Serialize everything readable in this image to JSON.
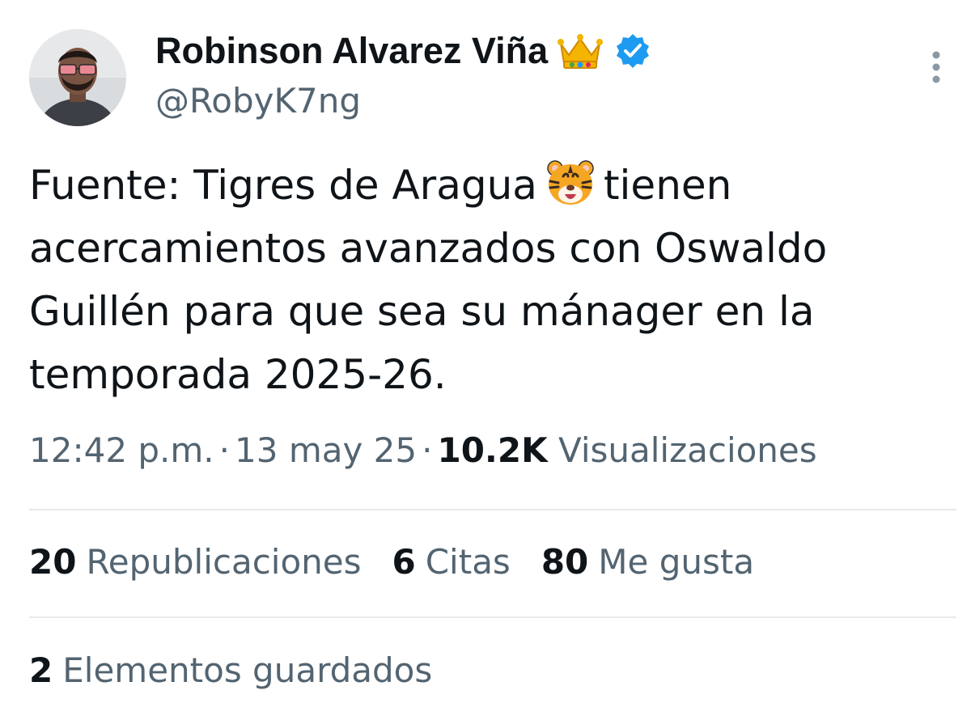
{
  "author": {
    "display_name": "Robinson Alvarez Viña",
    "handle": "@RobyK7ng",
    "badge_emoji": "crown-icon",
    "verified": true,
    "verified_color": "#1d9bf0"
  },
  "tweet": {
    "lines": [
      {
        "before": "Fuente: Tigres de Aragua",
        "emoji": "tiger-face-icon",
        "after": "tienen"
      },
      {
        "text": "acercamientos avanzados con Oswaldo"
      },
      {
        "text": "Guillén para que sea su mánager en la"
      },
      {
        "text": "temporada 2025-26."
      }
    ]
  },
  "meta": {
    "time": "12:42 p.m.",
    "separator": "·",
    "date": "13 may 25",
    "views_count": "10.2K",
    "views_label": "Visualizaciones"
  },
  "stats": {
    "reposts_count": "20",
    "reposts_label": "Republicaciones",
    "quotes_count": "6",
    "quotes_label": "Citas",
    "likes_count": "80",
    "likes_label": "Me gusta"
  },
  "bookmarks": {
    "count": "2",
    "label": "Elementos guardados"
  },
  "colors": {
    "text_primary": "#0f1419",
    "text_secondary": "#536471",
    "divider": "#e7e9eb"
  }
}
